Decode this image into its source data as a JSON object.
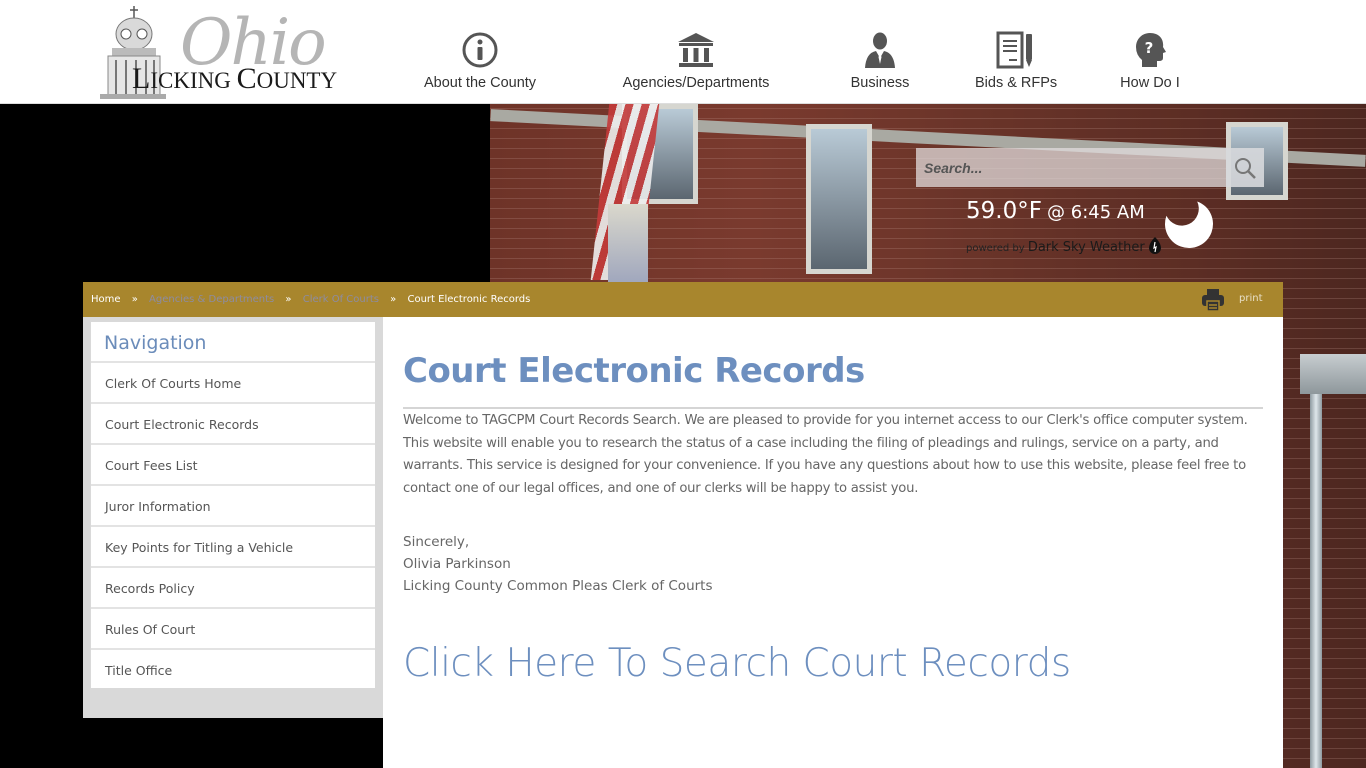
{
  "site": {
    "logo_script": "Ohio",
    "logo_name": "Licking County",
    "logo_name_parts": [
      "L",
      "ICKING ",
      "C",
      "OUNTY"
    ]
  },
  "topnav": [
    {
      "label": "About the County",
      "icon": "info-icon"
    },
    {
      "label": "Agencies/Departments",
      "icon": "building-icon"
    },
    {
      "label": "Business",
      "icon": "businessman-icon"
    },
    {
      "label": "Bids & RFPs",
      "icon": "document-pen-icon"
    },
    {
      "label": "How Do I",
      "icon": "question-head-icon"
    }
  ],
  "search": {
    "placeholder": "Search...",
    "value": "",
    "button_icon": "search-icon"
  },
  "weather": {
    "temperature": "59.0°F",
    "time": "@ 6:45 AM",
    "powered_by": "powered by",
    "provider": "Dark Sky Weather",
    "condition_icon": "moon-icon"
  },
  "breadcrumb": {
    "items": [
      "Home",
      "Agencies & Departments",
      "Clerk Of Courts",
      "Court Electronic Records"
    ],
    "separator": "»"
  },
  "print": {
    "label": "print"
  },
  "sidebar": {
    "title": "Navigation",
    "items": [
      {
        "label": "Clerk Of Courts Home"
      },
      {
        "label": "Court Electronic Records"
      },
      {
        "label": "Court Fees List"
      },
      {
        "label": "Juror Information"
      },
      {
        "label": "Key Points for Titling a Vehicle"
      },
      {
        "label": "Records Policy"
      },
      {
        "label": "Rules Of Court"
      },
      {
        "label": "Title Office"
      }
    ]
  },
  "main": {
    "title": "Court Electronic Records",
    "intro": "Welcome to TAGCPM Court Records Search. We are pleased to provide for you internet access to our Clerk's office computer system. This website will enable you to research the status of a case including the filing of pleadings and rulings, service on a party, and warrants. This service is designed for your convenience. If you have any questions about how to use this website, please feel free to contact one of our legal offices, and one of our clerks will be happy to assist you.",
    "signature": [
      "Sincerely,",
      "Olivia Parkinson",
      "Licking County Common Pleas Clerk of Courts"
    ],
    "search_link": "Click Here To Search Court Records"
  },
  "colors": {
    "accent_blue": "#6d8fbf",
    "breadcrumb_gold": "#a8862d",
    "sidebar_bg": "#d9d9d9",
    "body_text": "#666666"
  }
}
